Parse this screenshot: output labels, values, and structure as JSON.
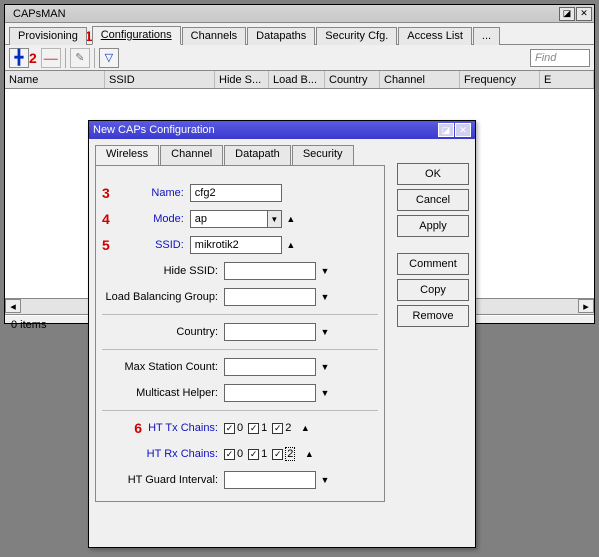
{
  "mainWindow": {
    "title": "CAPsMAN",
    "tabs": [
      "Provisioning",
      "Configurations",
      "Channels",
      "Datapaths",
      "Security Cfg.",
      "Access List",
      "..."
    ],
    "activeTab": 1,
    "findPlaceholder": "Find",
    "columns": [
      "Name",
      "SSID",
      "Hide S...",
      "Load B...",
      "Country",
      "Channel",
      "Frequency",
      "E"
    ],
    "status": "0 items",
    "scroll": {
      "left": "◂",
      "right": "▸"
    }
  },
  "annotations": {
    "a1": "1",
    "a2": "2",
    "a3": "3",
    "a4": "4",
    "a5": "5",
    "a6": "6"
  },
  "dialog": {
    "title": "New CAPs Configuration",
    "tabs": [
      "Wireless",
      "Channel",
      "Datapath",
      "Security"
    ],
    "activeTab": 0,
    "buttons": [
      "OK",
      "Cancel",
      "Apply",
      "Comment",
      "Copy",
      "Remove"
    ],
    "fields": {
      "nameLabel": "Name:",
      "nameValue": "cfg2",
      "modeLabel": "Mode:",
      "modeValue": "ap",
      "ssidLabel": "SSID:",
      "ssidValue": "mikrotik2",
      "hideSsidLabel": "Hide SSID:",
      "lbgLabel": "Load Balancing Group:",
      "countryLabel": "Country:",
      "maxStaLabel": "Max Station Count:",
      "mcastLabel": "Multicast Helper:",
      "htTxLabel": "HT Tx Chains:",
      "htRxLabel": "HT Rx Chains:",
      "htGuardLabel": "HT Guard Interval:",
      "ch0": "0",
      "ch1": "1",
      "ch2": "2"
    },
    "glyphs": {
      "down": "▼",
      "up": "▲",
      "check": "✓"
    }
  }
}
